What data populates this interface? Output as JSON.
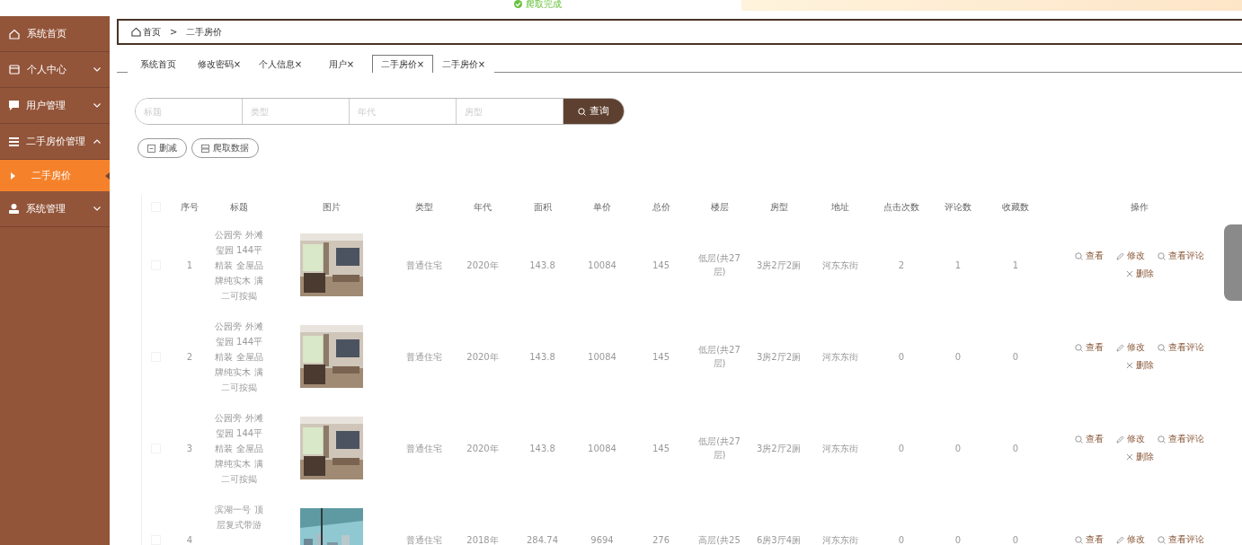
{
  "toast": {
    "text": "爬取完成"
  },
  "sidebar": {
    "items": [
      {
        "label": "系统首页",
        "kind": "link",
        "selected": false
      },
      {
        "label": "个人中心",
        "kind": "group",
        "selected": false,
        "expanded": false
      },
      {
        "label": "用户管理",
        "kind": "group",
        "selected": false,
        "expanded": false
      },
      {
        "label": "二手房价管理",
        "kind": "group",
        "selected": false,
        "expanded": true,
        "children": [
          {
            "label": "二手房价",
            "selected": true
          }
        ]
      },
      {
        "label": "系统管理",
        "kind": "group",
        "selected": false,
        "expanded": false
      }
    ]
  },
  "breadcrumb": {
    "items": [
      "首页",
      "二手房价"
    ],
    "separator": ">"
  },
  "tabs": [
    {
      "label": "系统首页",
      "closable": false,
      "selected": false
    },
    {
      "label": "修改密码",
      "closable": true,
      "selected": false
    },
    {
      "label": "个人信息",
      "closable": true,
      "selected": false
    },
    {
      "label": "用户",
      "closable": true,
      "selected": false
    },
    {
      "label": "二手房价",
      "closable": true,
      "selected": true
    },
    {
      "label": "二手房价",
      "closable": true,
      "selected": false
    }
  ],
  "close_mark": "×",
  "search": {
    "fields": [
      {
        "placeholder": "标题"
      },
      {
        "placeholder": "类型"
      },
      {
        "placeholder": "年代"
      },
      {
        "placeholder": "房型"
      }
    ],
    "button": "查询"
  },
  "actions": [
    {
      "label": "删减",
      "kind": "delete"
    },
    {
      "label": "爬取数据",
      "kind": "crawl"
    }
  ],
  "table": {
    "all_checked": false,
    "columns": [
      "序号",
      "标题",
      "图片",
      "类型",
      "年代",
      "面积",
      "单价",
      "总价",
      "楼层",
      "房型",
      "地址",
      "点击次数",
      "评论数",
      "收藏数",
      "操作"
    ],
    "rows": [
      {
        "checked": false,
        "cells": [
          "1",
          "公园旁 外滩玺园 144平精装 全屋品牌纯实木 满二可按揭",
          {
            "kind": "picture"
          },
          "普通住宅",
          "2020年",
          "143.8",
          "10084",
          "145",
          "低层(共27层)",
          "3房2厅2厕",
          "河东东街",
          "2",
          "1",
          "1"
        ],
        "row_actions": [
          {
            "label": "查看",
            "kind": "view"
          },
          {
            "label": "修改",
            "kind": "edit"
          },
          {
            "label": "查看评论",
            "kind": "view"
          },
          {
            "label": "删除",
            "kind": "delete"
          }
        ]
      },
      {
        "checked": false,
        "cells": [
          "2",
          "公园旁 外滩玺园 144平精装 全屋品牌纯实木 满二可按揭",
          {
            "kind": "picture"
          },
          "普通住宅",
          "2020年",
          "143.8",
          "10084",
          "145",
          "低层(共27层)",
          "3房2厅2厕",
          "河东东街",
          "0",
          "0",
          "0"
        ],
        "row_actions": [
          {
            "label": "查看",
            "kind": "view"
          },
          {
            "label": "修改",
            "kind": "edit"
          },
          {
            "label": "查看评论",
            "kind": "view"
          },
          {
            "label": "删除",
            "kind": "delete"
          }
        ]
      },
      {
        "checked": false,
        "cells": [
          "3",
          "公园旁 外滩玺园 144平精装 全屋品牌纯实木 满二可按揭",
          {
            "kind": "picture"
          },
          "普通住宅",
          "2020年",
          "143.8",
          "10084",
          "145",
          "低层(共27层)",
          "3房2厅2厕",
          "河东东街",
          "0",
          "0",
          "0"
        ],
        "row_actions": [
          {
            "label": "查看",
            "kind": "view"
          },
          {
            "label": "修改",
            "kind": "edit"
          },
          {
            "label": "查看评论",
            "kind": "view"
          },
          {
            "label": "删除",
            "kind": "delete"
          }
        ]
      },
      {
        "checked": false,
        "cells": [
          "4",
          "滨湖一号 顶层复式带游",
          {
            "kind": "picture"
          },
          "普通住宅",
          "2018年",
          "284.74",
          "9694",
          "276",
          "高层(共25",
          "6房3厅4厕",
          "河东东街",
          "0",
          "0",
          "0"
        ],
        "row_actions": [
          {
            "label": "查看",
            "kind": "view"
          },
          {
            "label": "修改",
            "kind": "edit"
          },
          {
            "label": "查看评论",
            "kind": "view"
          }
        ]
      }
    ]
  }
}
